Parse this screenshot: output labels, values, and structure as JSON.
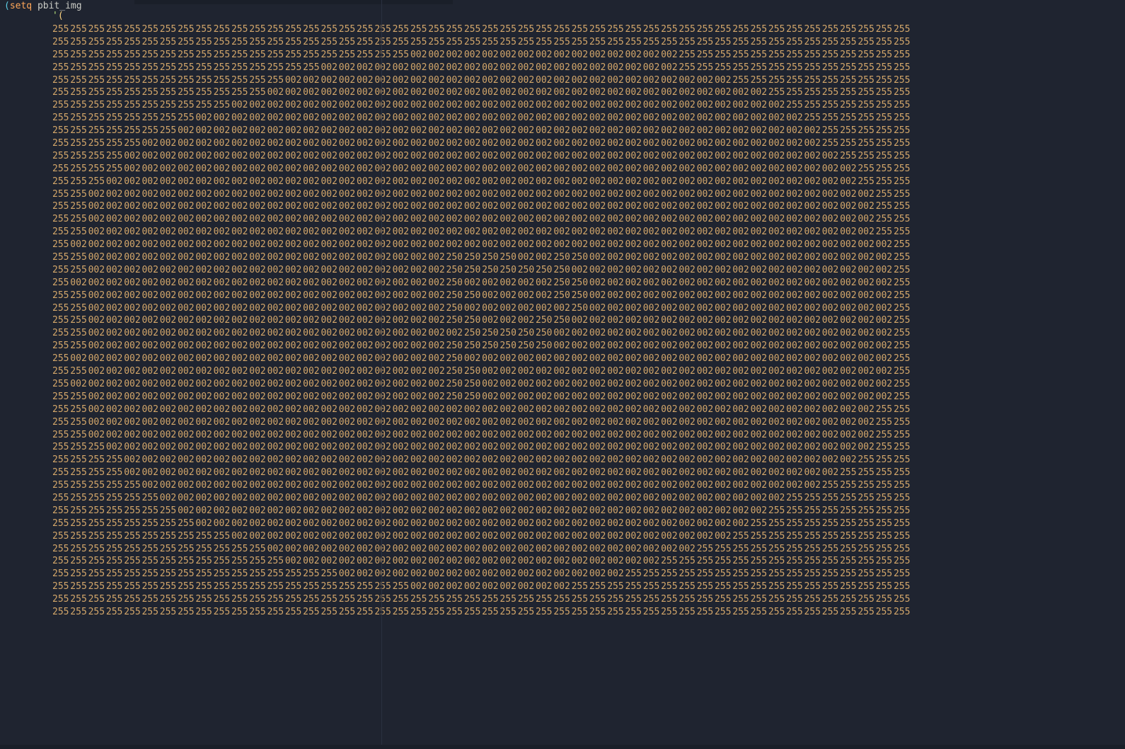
{
  "header": {
    "setq_open": "(",
    "setq_kw": "setq",
    "setq_var": "pbit_img",
    "quote": "'",
    "list_open": "("
  },
  "grid": {
    "tokens_per_row": 48,
    "a": "255",
    "b": "002",
    "c": "250",
    "rows": [
      "aaaaaaaaaaaaaaaaaaaaaaaaaaaaaaaaaaaaaaaaaaaaaaaa",
      "aaaaaaaaaaaaaaaaaaaaaaaaaaaaaaaaaaaaaaaaaaaaaaaa",
      "aaaaaaaaaaaaaaaaaaaabbbbbbbbbbbbbbbaaaaaaaaaaaaa",
      "aaaaaaaaaaaaaaabbbbbbbbbbbbbbbbbbbbaaaaaaaaaaaaa",
      "aaaaaaaaaaaaabbbbbbbbbbbbbbbbbbbbbbbbbaaaaaaaaaa",
      "aaaaaaaaaaaabbbbbbbbbbbbbbbbbbbbbbbbbbbbaaaaaaaa",
      "aaaaaaaaaabbbbbbbbbbbbbbbbbbbbbbbbbbbbbbbaaaaaaa",
      "aaaaaaaabbbbbbbbbbbbbbbbbbbbbbbbbbbbbbbbbbaaaaaa",
      "aaaaaaabbbbbbbbbbbbbbbbbbbbbbbbbbbbbbbbbbbbaaaaa",
      "aaaaabbbbbbbbbbbbbbbbbbbbbbbbbbbbbbbbbbbbbbaaaaa",
      "aaaabbbbbbbbbbbbbbbbbbbbbbbbbbbbbbbbbbbbbbbbaaaa",
      "aaaabbbbbbbbbbbbbbbbbbbbbbbbbbbbbbbbbbbbbbbbbaaa",
      "aaabbbbbbbbbbbbbbbbbbbbbbbbbbbbbbbbbbbbbbbbbbaaa",
      "aabbbbbbbbbbbbbbbbbbbbbbbbbbbbbbbbbbbbbbbbbbbbaa",
      "aabbbbbbbbbbbbbbbbbbbbbbbbbbbbbbbbbbbbbbbbbbbbaa",
      "aabbbbbbbbbbbbbbbbbbbbbbbbbbbbbbbbbbbbbbbbbbbbaa",
      "aabbbbbbbbbbbbbbbbbbbbbbbbbbbbbbbbbbbbbbbbbbbbaa",
      "abbbbbbbbbbbbbbbbbbbbbbbbbbbbbbbbbbbbbbbbbbbbbba",
      "aabbbbbbbbbbbbbbbbbbbbccccbbccbbbbbbbbbbbbbbbbba",
      "aabbbbbbbbbbbbbbbbbbbbcccccccbbbbbbbbbbbbbbbbbba",
      "abbbbbbbbbbbbbbbbbbbbbcbbbbbccbbbbbbbbbbbbbbbbba",
      "aabbbbbbbbbbbbbbbbbbbbccbbbbccbbbbbbbbbbbbbbbbba",
      "aabbbbbbbbbbbbbbbbbbbbcbbbbbbcbbbbbbbbbbbbbbbbba",
      "aabbbbbbbbbbbbbbbbbbbbccbbbccbbbbbbbbbbbbbbbbbba",
      "aabbbbbbbbbbbbbbbbbbbbbcccccbbbbbbbbbbbbbbbbbbba",
      "aabbbbbbbbbbbbbbbbbbbbccccccbbbbbbbbbbbbbbbbbbba",
      "abbbbbbbbbbbbbbbbbbbbbcbbbbbbbbbbbbbbbbbbbbbbbba",
      "aabbbbbbbbbbbbbbbbbbbbccbbbbbbbbbbbbbbbbbbbbbbba",
      "abbbbbbbbbbbbbbbbbbbbbccbbbbbbbbbbbbbbbbbbbbbbba",
      "aabbbbbbbbbbbbbbbbbbbbccbbbbbbbbbbbbbbbbbbbbbbba",
      "aabbbbbbbbbbbbbbbbbbbbbbbbbbbbbbbbbbbbbbbbbbbbaa",
      "aabbbbbbbbbbbbbbbbbbbbbbbbbbbbbbbbbbbbbbbbbbbbaa",
      "aabbbbbbbbbbbbbbbbbbbbbbbbbbbbbbbbbbbbbbbbbbbbaa",
      "aaabbbbbbbbbbbbbbbbbbbbbbbbbbbbbbbbbbbbbbbbbbbaa",
      "aaaabbbbbbbbbbbbbbbbbbbbbbbbbbbbbbbbbbbbbbbbbaaa",
      "aaaabbbbbbbbbbbbbbbbbbbbbbbbbbbbbbbbbbbbbbbbaaaa",
      "aaaaabbbbbbbbbbbbbbbbbbbbbbbbbbbbbbbbbbbbbbaaaaa",
      "aaaaaabbbbbbbbbbbbbbbbbbbbbbbbbbbbbbbbbbbaaaaaaa",
      "aaaaaaabbbbbbbbbbbbbbbbbbbbbbbbbbbbbbbbbaaaaaaaa",
      "aaaaaaaabbbbbbbbbbbbbbbbbbbbbbbbbbbbbbbaaaaaaaaa",
      "aaaaaaaaaabbbbbbbbbbbbbbbbbbbbbbbbbbbbaaaaaaaaaa",
      "aaaaaaaaaaaabbbbbbbbbbbbbbbbbbbbbbbbaaaaaaaaaaaa",
      "aaaaaaaaaaaaabbbbbbbbbbbbbbbbbbbbbaaaaaaaaaaaaaa",
      "aaaaaaaaaaaaaaaabbbbbbbbbbbbbbbbaaaaaaaaaaaaaaaa",
      "aaaaaaaaaaaaaaaaaaaabbbbbbbbbaaaaaaaaaaaaaaaaaaa",
      "aaaaaaaaaaaaaaaaaaaaaaaaaaaaaaaaaaaaaaaaaaaaaaaa",
      "aaaaaaaaaaaaaaaaaaaaaaaaaaaaaaaaaaaaaaaaaaaaaaaa"
    ]
  }
}
